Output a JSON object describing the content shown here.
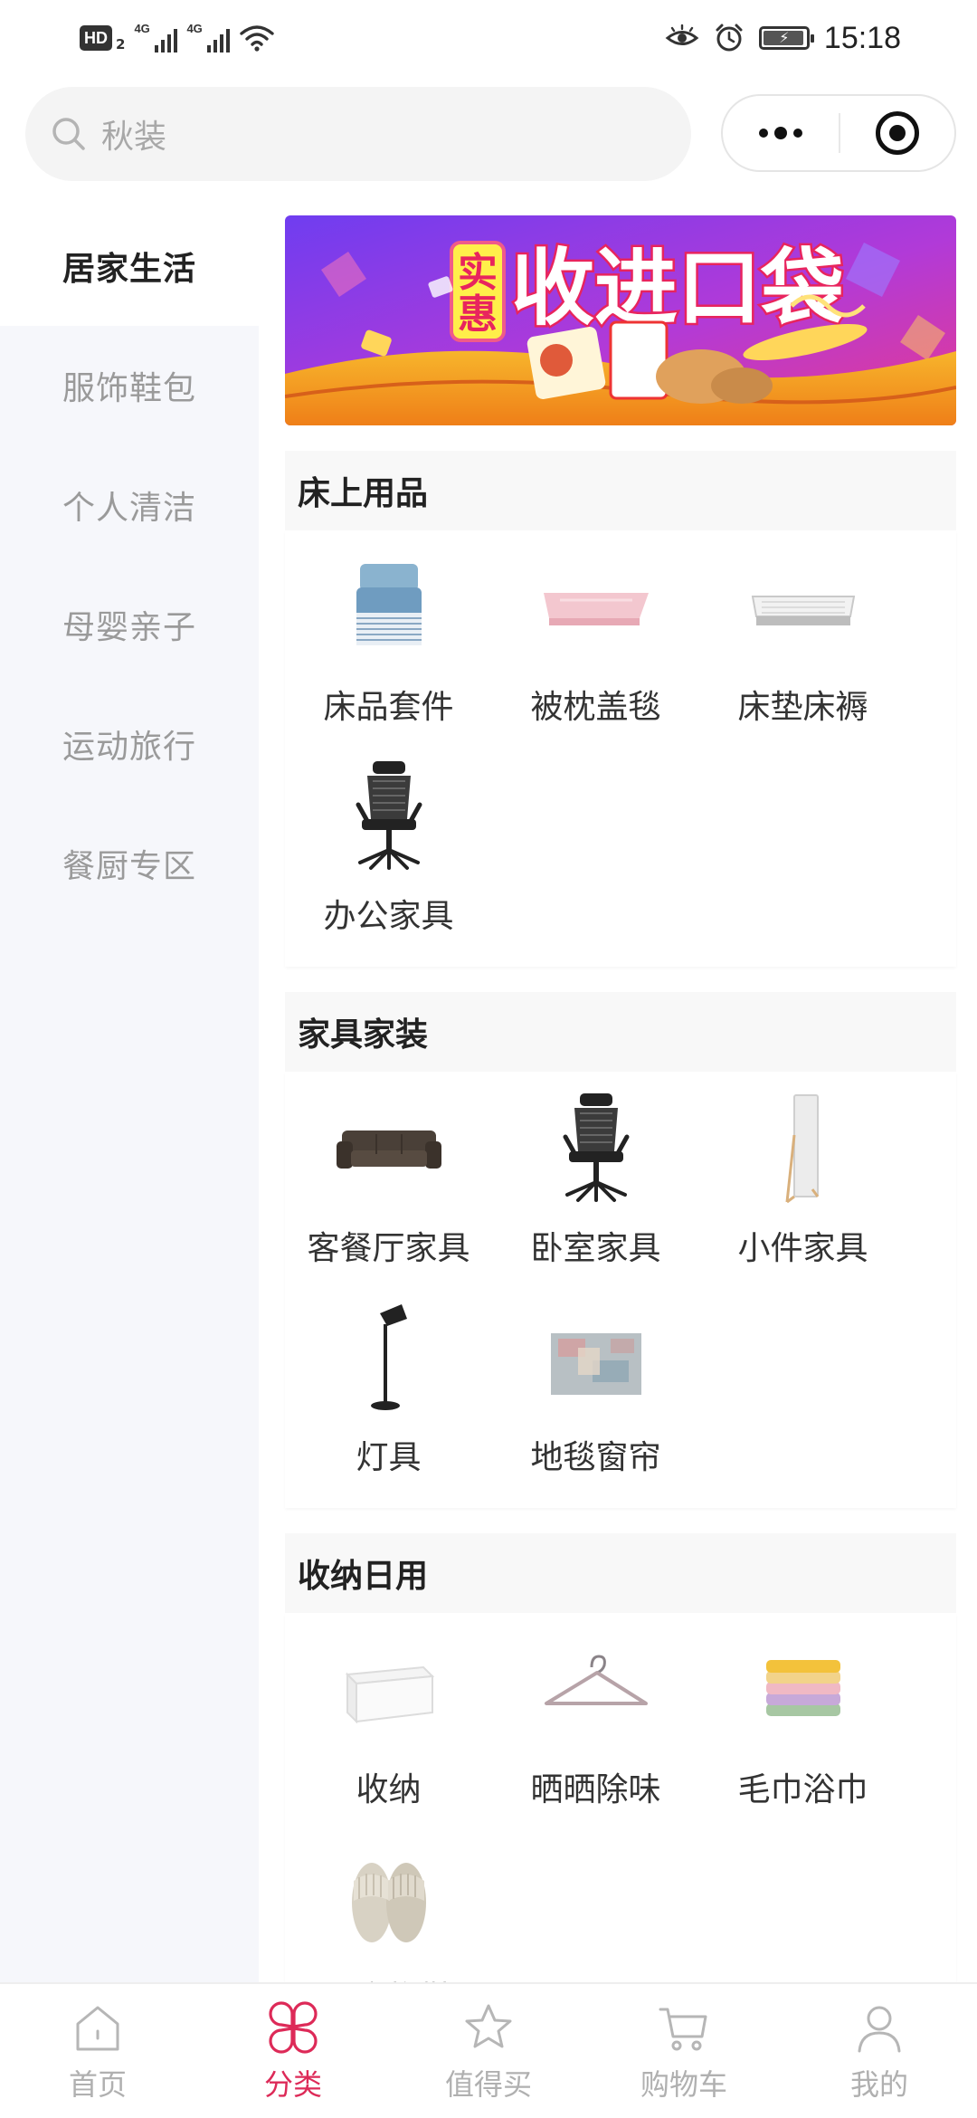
{
  "status_bar": {
    "hd": "HD",
    "hd_sub": "2",
    "network_1": "4G",
    "network_2": "4G",
    "time": "15:18"
  },
  "header": {
    "search_placeholder": "秋装"
  },
  "sidebar": {
    "items": [
      {
        "label": "居家生活",
        "active": true
      },
      {
        "label": "服饰鞋包",
        "active": false
      },
      {
        "label": "个人清洁",
        "active": false
      },
      {
        "label": "母婴亲子",
        "active": false
      },
      {
        "label": "运动旅行",
        "active": false
      },
      {
        "label": "餐厨专区",
        "active": false
      }
    ]
  },
  "banner": {
    "headline_1": "实",
    "headline_2": "惠",
    "headline_main": "收进口袋",
    "colors": {
      "bg_top": "#8d3ae8",
      "bg_bottom": "#f39a1e",
      "accent": "#f53c6b"
    }
  },
  "sections": [
    {
      "title": "床上用品",
      "items": [
        {
          "label": "床品套件",
          "icon": "bedding-set-icon"
        },
        {
          "label": "被枕盖毯",
          "icon": "blanket-icon"
        },
        {
          "label": "床垫床褥",
          "icon": "mattress-icon"
        },
        {
          "label": "办公家具",
          "icon": "office-chair-icon"
        }
      ]
    },
    {
      "title": "家具家装",
      "items": [
        {
          "label": "客餐厅家具",
          "icon": "sofa-icon"
        },
        {
          "label": "卧室家具",
          "icon": "office-chair-icon"
        },
        {
          "label": "小件家具",
          "icon": "mirror-icon"
        },
        {
          "label": "灯具",
          "icon": "floor-lamp-icon"
        },
        {
          "label": "地毯窗帘",
          "icon": "rug-icon"
        }
      ]
    },
    {
      "title": "收纳日用",
      "items": [
        {
          "label": "收纳",
          "icon": "storage-box-icon"
        },
        {
          "label": "晒晒除味",
          "icon": "hanger-icon"
        },
        {
          "label": "毛巾浴巾",
          "icon": "towels-icon"
        },
        {
          "label": "居家拖鞋",
          "icon": "slippers-icon"
        }
      ]
    }
  ],
  "tabbar": {
    "tabs": [
      {
        "label": "首页",
        "icon": "home-icon",
        "active": false
      },
      {
        "label": "分类",
        "icon": "category-icon",
        "active": true
      },
      {
        "label": "值得买",
        "icon": "star-icon",
        "active": false
      },
      {
        "label": "购物车",
        "icon": "cart-icon",
        "active": false
      },
      {
        "label": "我的",
        "icon": "user-icon",
        "active": false
      }
    ],
    "active_color": "#dd2a58",
    "inactive_color": "#b0b0b0"
  }
}
